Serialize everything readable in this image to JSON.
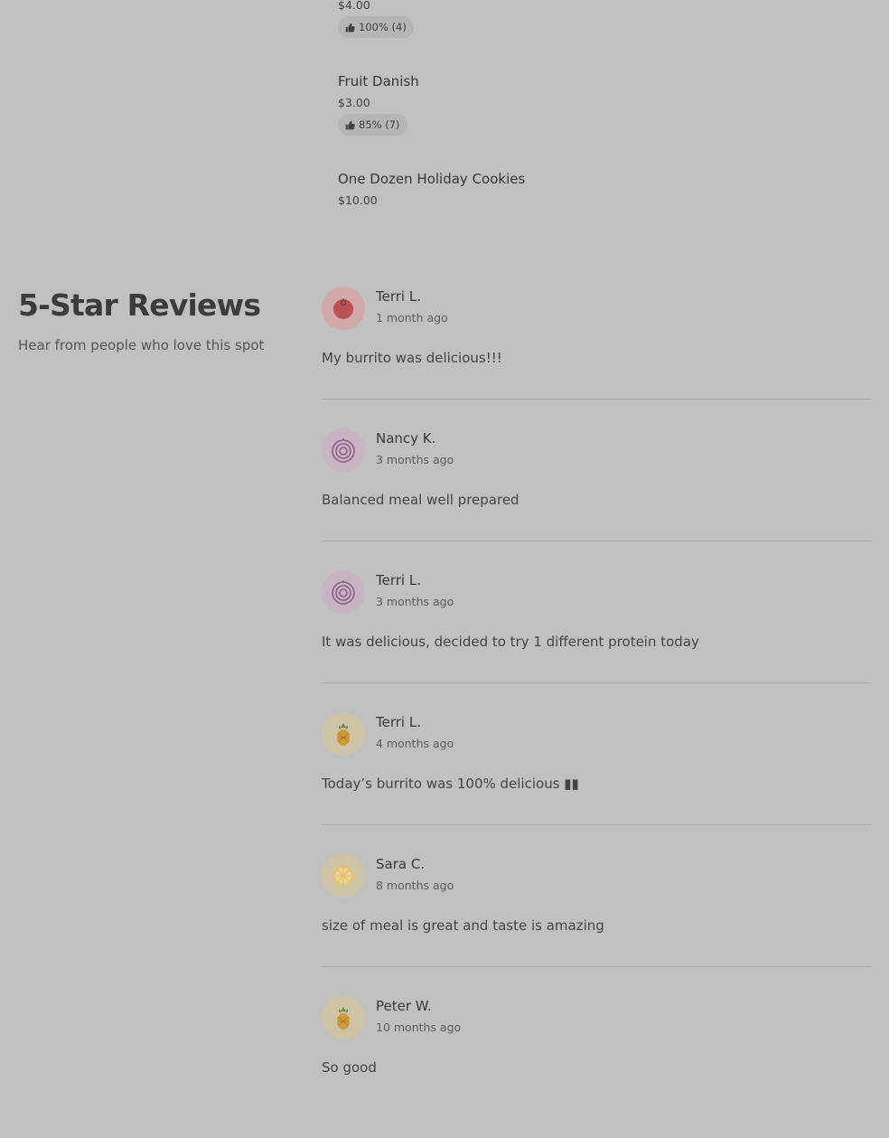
{
  "menu_items": [
    {
      "name": "",
      "price": "$4.00",
      "rating": "100% (4)"
    },
    {
      "name": "Fruit Danish",
      "price": "$3.00",
      "rating": "85% (7)"
    },
    {
      "name": "One Dozen Holiday Cookies",
      "price": "$10.00",
      "rating": ""
    }
  ],
  "reviews_section": {
    "title": "5-Star Reviews",
    "subtitle": "Hear from people who love this spot"
  },
  "reviews": [
    {
      "name": "Terri L.",
      "date": "1 month ago",
      "text": "My burrito was delicious!!!",
      "avatar_icon": "tomato-icon",
      "avatar_color": "#d2a8a9"
    },
    {
      "name": "Nancy K.",
      "date": "3 months ago",
      "text": "Balanced meal well prepared",
      "avatar_icon": "onion-icon",
      "avatar_color": "#c8b3c2"
    },
    {
      "name": "Terri L.",
      "date": "3 months ago",
      "text": "It was delicious, decided to try 1 different protein today",
      "avatar_icon": "onion-icon",
      "avatar_color": "#c8b3c2"
    },
    {
      "name": "Terri L.",
      "date": "4 months ago",
      "text": "Today’s burrito was 100% delicious ▮▮",
      "avatar_icon": "pineapple-icon",
      "avatar_color": "#cfc3a6"
    },
    {
      "name": "Sara C.",
      "date": "8 months ago",
      "text": "size of meal is great and taste is amazing",
      "avatar_icon": "lemon-slice-icon",
      "avatar_color": "#cfc3a6"
    },
    {
      "name": "Peter W.",
      "date": "10 months ago",
      "text": "So good",
      "avatar_icon": "pineapple-icon",
      "avatar_color": "#cfc3a6"
    }
  ]
}
